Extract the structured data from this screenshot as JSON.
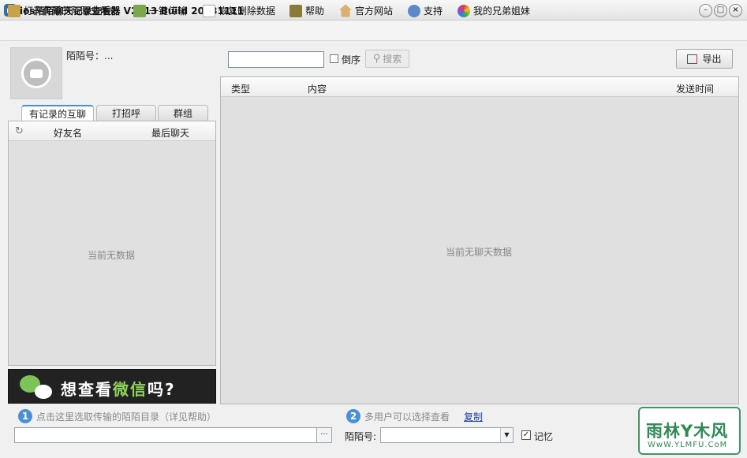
{
  "window": {
    "title": "ios陌陌聊天记录查看器 V2013 Build 20131111",
    "minimize": "–",
    "maximize": "□",
    "close": "×"
  },
  "toolbar": {
    "items": [
      {
        "label": "打开传输的陌陌文件夹",
        "icon": "folder-icon",
        "color": "#c8a24a"
      },
      {
        "label": "一键传输",
        "icon": "transfer-icon",
        "color": "#7aa84a"
      },
      {
        "label": "恢复删除数据",
        "icon": "restore-icon",
        "color": "#c0c0c0"
      },
      {
        "label": "帮助",
        "icon": "book-icon",
        "color": "#8a7a3a"
      },
      {
        "label": "官方网站",
        "icon": "home-icon",
        "color": "#b88a3a"
      },
      {
        "label": "支持",
        "icon": "people-icon",
        "color": "#5a8ac8"
      },
      {
        "label": "我的兄弟姐妹",
        "icon": "colorwheel-icon",
        "color": "#e04040"
      }
    ]
  },
  "profile": {
    "momo_label": "陌陌号：...",
    "avatar_color": "#bfbfbf"
  },
  "tabs": [
    "有记录的互聊",
    "打招呼",
    "群组"
  ],
  "friend_list": {
    "col_refresh": "↻",
    "col_name": "好友名",
    "col_last": "最后聊天",
    "empty": "当前无数据"
  },
  "ad": {
    "prefix": "想查看",
    "highlight": "微信",
    "suffix": "吗?"
  },
  "search": {
    "value": "",
    "reverse_label": "倒序",
    "button": "搜索",
    "button_icon": "⚲",
    "export": "导出"
  },
  "messages": {
    "col_type": "类型",
    "col_content": "内容",
    "col_time": "发送时间",
    "empty": "当前无聊天数据"
  },
  "bottom": {
    "step1_num": "1",
    "step1_text": "点击这里选取传输的陌陌目录（详见帮助）",
    "step2_num": "2",
    "step2_text": "多用户可以选择查看",
    "copy_link": "复制",
    "browse": "···",
    "momo_label": "陌陌号:",
    "select_arrow": "▼",
    "remember_label": "记忆",
    "remember_checked": true,
    "check_mark": "✓"
  },
  "watermark": {
    "main": "雨林Y木风",
    "sub": "WwW.YLMFU.CoM"
  }
}
